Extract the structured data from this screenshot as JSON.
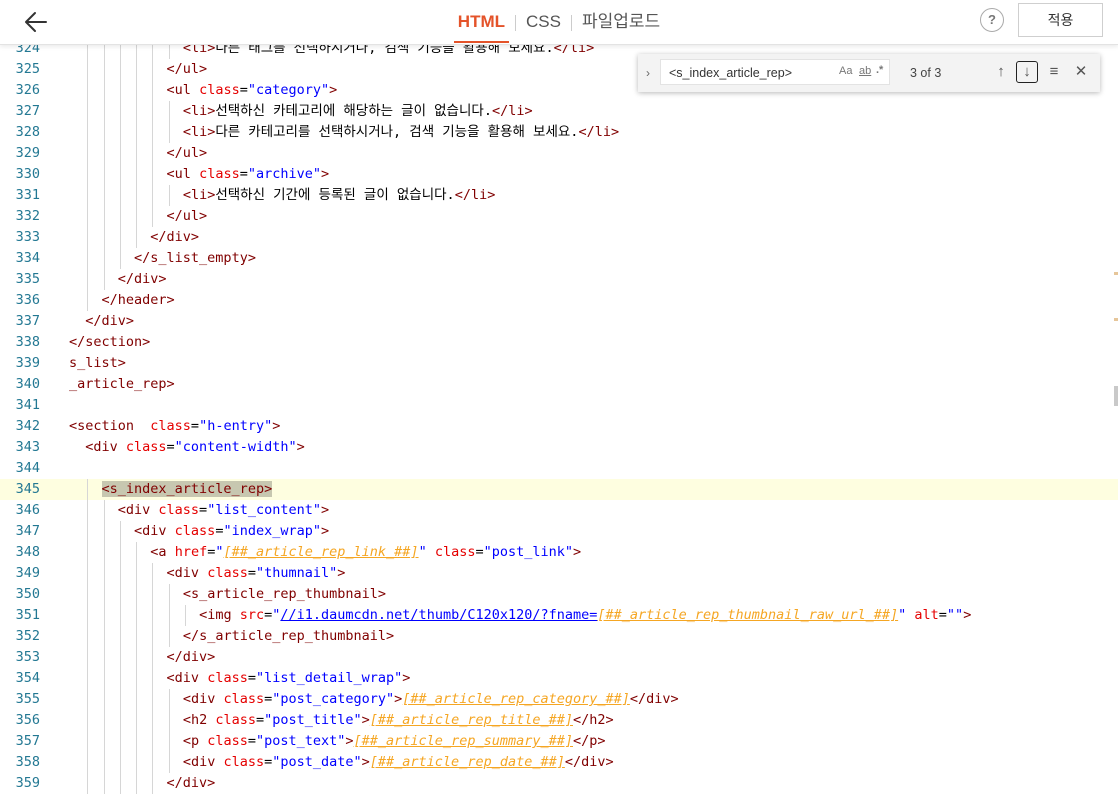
{
  "header": {
    "tabs": [
      {
        "label": "HTML",
        "active": true
      },
      {
        "label": "CSS",
        "active": false
      },
      {
        "label": "파일업로드",
        "active": false
      }
    ],
    "help_label": "?",
    "apply_label": "적용"
  },
  "find": {
    "query": "<s_index_article_rep>",
    "options": [
      "Aa",
      "ab",
      ".*"
    ],
    "count": "3 of 3"
  },
  "editor": {
    "current_line": 345,
    "lines": [
      {
        "n": "324",
        "indent": 7,
        "tokens": [
          [
            "tag",
            "<li>"
          ],
          [
            "text",
            "다른 태그를 선택하시거나, 검색 기능을 활용해 보세요."
          ],
          [
            "tag",
            "</li>"
          ]
        ]
      },
      {
        "n": "325",
        "indent": 6,
        "tokens": [
          [
            "tag",
            "</ul>"
          ]
        ]
      },
      {
        "n": "326",
        "indent": 6,
        "tokens": [
          [
            "tag",
            "<ul "
          ],
          [
            "attr",
            "class"
          ],
          [
            "text",
            "="
          ],
          [
            "str",
            "\"category\""
          ],
          [
            "tag",
            ">"
          ]
        ]
      },
      {
        "n": "327",
        "indent": 7,
        "tokens": [
          [
            "tag",
            "<li>"
          ],
          [
            "text",
            "선택하신 카테고리에 해당하는 글이 없습니다."
          ],
          [
            "tag",
            "</li>"
          ]
        ]
      },
      {
        "n": "328",
        "indent": 7,
        "tokens": [
          [
            "tag",
            "<li>"
          ],
          [
            "text",
            "다른 카테고리를 선택하시거나, 검색 기능을 활용해 보세요."
          ],
          [
            "tag",
            "</li>"
          ]
        ]
      },
      {
        "n": "329",
        "indent": 6,
        "tokens": [
          [
            "tag",
            "</ul>"
          ]
        ]
      },
      {
        "n": "330",
        "indent": 6,
        "tokens": [
          [
            "tag",
            "<ul "
          ],
          [
            "attr",
            "class"
          ],
          [
            "text",
            "="
          ],
          [
            "str",
            "\"archive\""
          ],
          [
            "tag",
            ">"
          ]
        ]
      },
      {
        "n": "331",
        "indent": 7,
        "tokens": [
          [
            "tag",
            "<li>"
          ],
          [
            "text",
            "선택하신 기간에 등록된 글이 없습니다."
          ],
          [
            "tag",
            "</li>"
          ]
        ]
      },
      {
        "n": "332",
        "indent": 6,
        "tokens": [
          [
            "tag",
            "</ul>"
          ]
        ]
      },
      {
        "n": "333",
        "indent": 5,
        "tokens": [
          [
            "tag",
            "</div>"
          ]
        ]
      },
      {
        "n": "334",
        "indent": 4,
        "tokens": [
          [
            "tag",
            "</s_list_empty>"
          ]
        ]
      },
      {
        "n": "335",
        "indent": 3,
        "tokens": [
          [
            "tag",
            "</div>"
          ]
        ]
      },
      {
        "n": "336",
        "indent": 2,
        "tokens": [
          [
            "tag",
            "</header>"
          ]
        ]
      },
      {
        "n": "337",
        "indent": 1,
        "tokens": [
          [
            "tag",
            "</div>"
          ]
        ]
      },
      {
        "n": "338",
        "indent": 0,
        "tokens": [
          [
            "tag",
            "</section>"
          ]
        ]
      },
      {
        "n": "339",
        "indent": 0,
        "tokens": [
          [
            "tag",
            "s_list>"
          ]
        ]
      },
      {
        "n": "340",
        "indent": 0,
        "tokens": [
          [
            "tag",
            "_article_rep>"
          ]
        ]
      },
      {
        "n": "341",
        "indent": 0,
        "tokens": []
      },
      {
        "n": "342",
        "indent": 0,
        "tokens": [
          [
            "tag",
            "<section  "
          ],
          [
            "attr",
            "class"
          ],
          [
            "text",
            "="
          ],
          [
            "str",
            "\"h-entry\""
          ],
          [
            "tag",
            ">"
          ]
        ]
      },
      {
        "n": "343",
        "indent": 1,
        "tokens": [
          [
            "tag",
            "<div "
          ],
          [
            "attr",
            "class"
          ],
          [
            "text",
            "="
          ],
          [
            "str",
            "\"content-width\""
          ],
          [
            "tag",
            ">"
          ]
        ]
      },
      {
        "n": "344",
        "indent": 0,
        "tokens": []
      },
      {
        "n": "345",
        "indent": 2,
        "tokens": [
          [
            "sel",
            "<s_index_article_rep>"
          ]
        ]
      },
      {
        "n": "346",
        "indent": 3,
        "tokens": [
          [
            "tag",
            "<div "
          ],
          [
            "attr",
            "class"
          ],
          [
            "text",
            "="
          ],
          [
            "str",
            "\"list_content\""
          ],
          [
            "tag",
            ">"
          ]
        ]
      },
      {
        "n": "347",
        "indent": 4,
        "tokens": [
          [
            "tag",
            "<div "
          ],
          [
            "attr",
            "class"
          ],
          [
            "text",
            "="
          ],
          [
            "str",
            "\"index_wrap\""
          ],
          [
            "tag",
            ">"
          ]
        ]
      },
      {
        "n": "348",
        "indent": 5,
        "tokens": [
          [
            "tag",
            "<a "
          ],
          [
            "attr",
            "href"
          ],
          [
            "text",
            "="
          ],
          [
            "str",
            "\""
          ],
          [
            "tmpl",
            "[##_article_rep_link_##]"
          ],
          [
            "str",
            "\""
          ],
          [
            "text",
            " "
          ],
          [
            "attr",
            "class"
          ],
          [
            "text",
            "="
          ],
          [
            "str",
            "\"post_link\""
          ],
          [
            "tag",
            ">"
          ]
        ]
      },
      {
        "n": "349",
        "indent": 6,
        "tokens": [
          [
            "tag",
            "<div "
          ],
          [
            "attr",
            "class"
          ],
          [
            "text",
            "="
          ],
          [
            "str",
            "\"thumnail\""
          ],
          [
            "tag",
            ">"
          ]
        ]
      },
      {
        "n": "350",
        "indent": 7,
        "tokens": [
          [
            "tag",
            "<s_article_rep_thumbnail>"
          ]
        ]
      },
      {
        "n": "351",
        "indent": 8,
        "tokens": [
          [
            "tag",
            "<img "
          ],
          [
            "attr",
            "src"
          ],
          [
            "text",
            "="
          ],
          [
            "str",
            "\""
          ],
          [
            "url",
            "//i1.daumcdn.net/thumb/C120x120/?fname="
          ],
          [
            "tmpl",
            "[##_article_rep_thumbnail_raw_url_##]"
          ],
          [
            "str",
            "\""
          ],
          [
            "text",
            " "
          ],
          [
            "attr",
            "alt"
          ],
          [
            "text",
            "="
          ],
          [
            "str",
            "\"\""
          ],
          [
            "tag",
            ">"
          ]
        ]
      },
      {
        "n": "352",
        "indent": 7,
        "tokens": [
          [
            "tag",
            "</s_article_rep_thumbnail>"
          ]
        ]
      },
      {
        "n": "353",
        "indent": 6,
        "tokens": [
          [
            "tag",
            "</div>"
          ]
        ]
      },
      {
        "n": "354",
        "indent": 6,
        "tokens": [
          [
            "tag",
            "<div "
          ],
          [
            "attr",
            "class"
          ],
          [
            "text",
            "="
          ],
          [
            "str",
            "\"list_detail_wrap\""
          ],
          [
            "tag",
            ">"
          ]
        ]
      },
      {
        "n": "355",
        "indent": 7,
        "tokens": [
          [
            "tag",
            "<div "
          ],
          [
            "attr",
            "class"
          ],
          [
            "text",
            "="
          ],
          [
            "str",
            "\"post_category\""
          ],
          [
            "tag",
            ">"
          ],
          [
            "tmpl",
            "[##_article_rep_category_##]"
          ],
          [
            "tag",
            "</div>"
          ]
        ]
      },
      {
        "n": "356",
        "indent": 7,
        "tokens": [
          [
            "tag",
            "<h2 "
          ],
          [
            "attr",
            "class"
          ],
          [
            "text",
            "="
          ],
          [
            "str",
            "\"post_title\""
          ],
          [
            "tag",
            ">"
          ],
          [
            "tmpl",
            "[##_article_rep_title_##]"
          ],
          [
            "tag",
            "</h2>"
          ]
        ]
      },
      {
        "n": "357",
        "indent": 7,
        "tokens": [
          [
            "tag",
            "<p "
          ],
          [
            "attr",
            "class"
          ],
          [
            "text",
            "="
          ],
          [
            "str",
            "\"post_text\""
          ],
          [
            "tag",
            ">"
          ],
          [
            "tmpl",
            "[##_article_rep_summary_##]"
          ],
          [
            "tag",
            "</p>"
          ]
        ]
      },
      {
        "n": "358",
        "indent": 7,
        "tokens": [
          [
            "tag",
            "<div "
          ],
          [
            "attr",
            "class"
          ],
          [
            "text",
            "="
          ],
          [
            "str",
            "\"post_date\""
          ],
          [
            "tag",
            ">"
          ],
          [
            "tmpl",
            "[##_article_rep_date_##]"
          ],
          [
            "tag",
            "</div>"
          ]
        ]
      },
      {
        "n": "359",
        "indent": 6,
        "tokens": [
          [
            "tag",
            "</div>"
          ]
        ]
      }
    ]
  }
}
